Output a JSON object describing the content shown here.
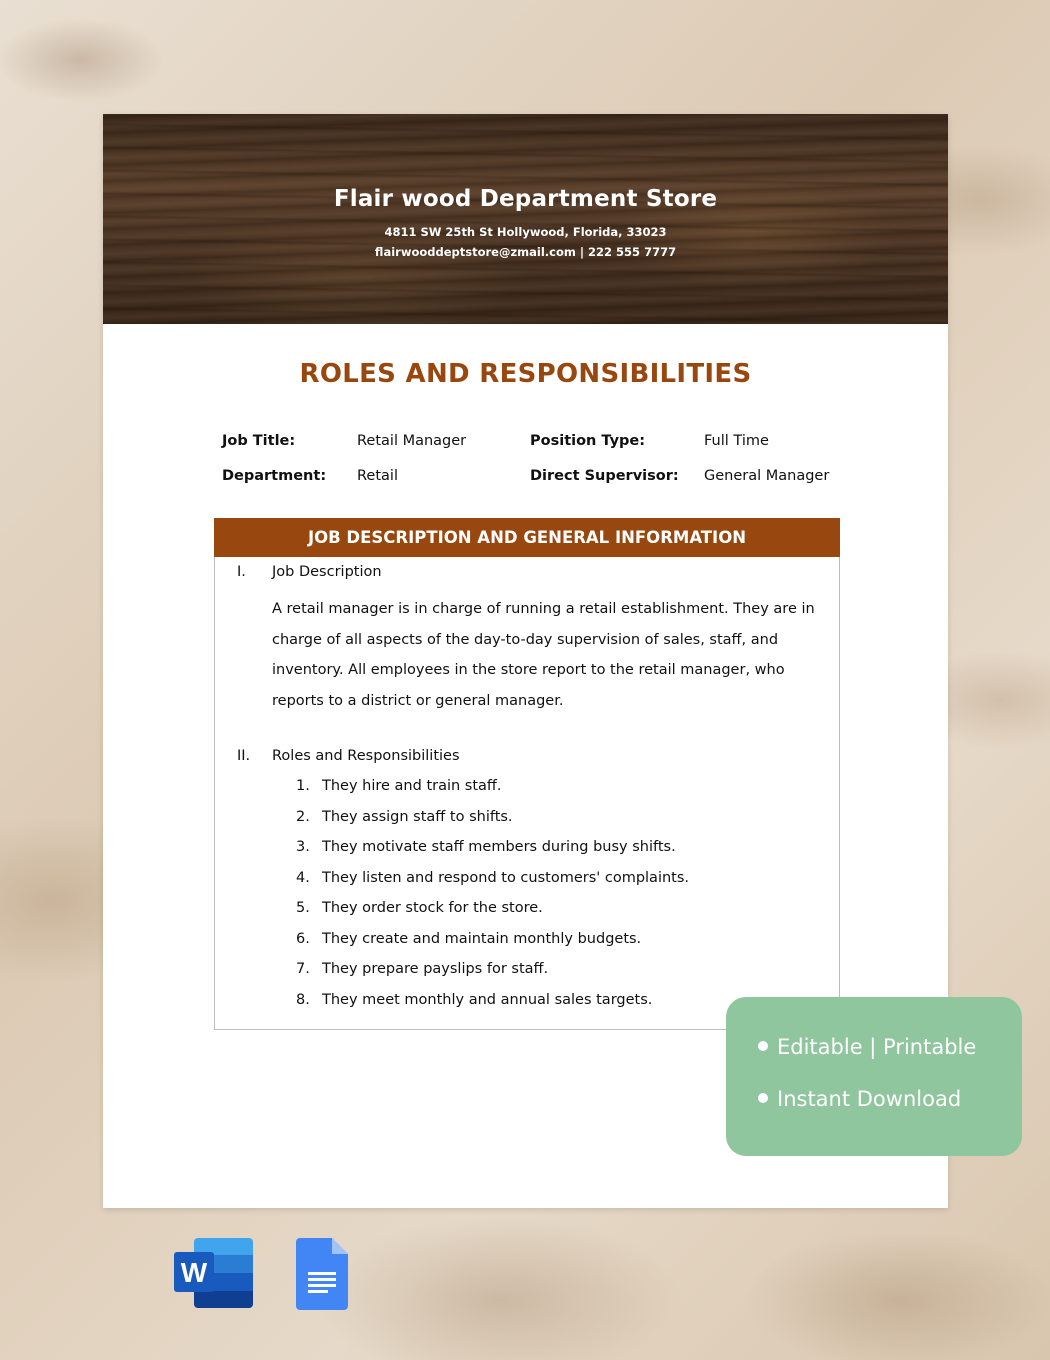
{
  "store": {
    "name": "Flair wood Department Store",
    "address": "4811 SW 25th St Hollywood, Florida, 33023",
    "contact": "flairwooddeptstore@zmail.com | 222 555 7777"
  },
  "document": {
    "title": "ROLES AND RESPONSIBILITIES",
    "info": [
      {
        "label": "Job Title:",
        "value": "Retail Manager",
        "label2": "Position Type:",
        "value2": "Full Time"
      },
      {
        "label": "Department:",
        "value": "Retail",
        "label2": "Direct Supervisor:",
        "value2": "General Manager"
      }
    ],
    "section": {
      "header": "JOB DESCRIPTION AND GENERAL INFORMATION",
      "parts": [
        {
          "numeral": "I.",
          "heading": "Job Description",
          "text": "A retail manager is in charge of running a retail establishment. They are in charge of all aspects of the day-to-day supervision of sales, staff, and inventory. All employees in the store report to the retail manager, who reports to a district or general manager."
        },
        {
          "numeral": "II.",
          "heading": "Roles and Responsibilities",
          "items": [
            {
              "num": "1.",
              "text": "They hire and train staff."
            },
            {
              "num": "2.",
              "text": "They assign staff to shifts."
            },
            {
              "num": "3.",
              "text": "They motivate staff members during busy shifts."
            },
            {
              "num": "4.",
              "text": "They listen and respond to customers' complaints."
            },
            {
              "num": "5.",
              "text": "They order stock for the store."
            },
            {
              "num": "6.",
              "text": "They create and maintain monthly budgets."
            },
            {
              "num": "7.",
              "text": "They prepare payslips for staff."
            },
            {
              "num": "8.",
              "text": "They meet monthly and annual sales targets."
            }
          ]
        }
      ]
    }
  },
  "promo": {
    "items": [
      "Editable | Printable",
      "Instant Download"
    ],
    "color": "#8fc69e"
  },
  "app_icons": [
    {
      "icon": "microsoft-word-icon",
      "letter": "W"
    },
    {
      "icon": "google-docs-icon"
    }
  ],
  "colors": {
    "accent": "#98470f",
    "promo_bg": "#8fc69e"
  }
}
